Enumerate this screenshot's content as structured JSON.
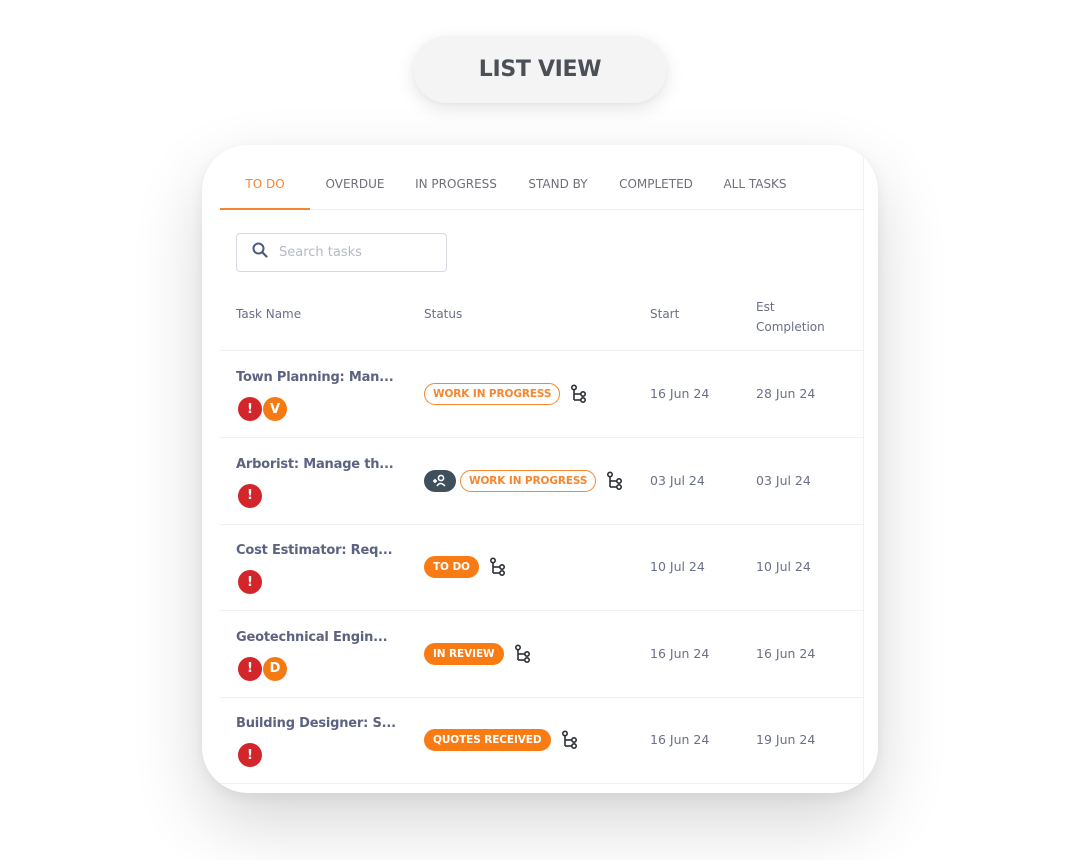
{
  "header": {
    "title": "LIST VIEW"
  },
  "tabs": [
    {
      "label": "TO DO",
      "active": true
    },
    {
      "label": "OVERDUE",
      "active": false
    },
    {
      "label": "IN PROGRESS",
      "active": false
    },
    {
      "label": "STAND BY",
      "active": false
    },
    {
      "label": "COMPLETED",
      "active": false
    },
    {
      "label": "ALL TASKS",
      "active": false
    }
  ],
  "search": {
    "placeholder": "Search tasks",
    "value": "",
    "icon": "search-icon"
  },
  "table": {
    "columns": {
      "name": "Task Name",
      "status": "Status",
      "start": "Start",
      "est_line1": "Est",
      "est_line2": "Completion"
    },
    "rows": [
      {
        "name": "Town Planning: Man...",
        "alert": "!",
        "avatar": "V",
        "assigned_icon": false,
        "status": "WORK IN PROGRESS",
        "status_style": "outline",
        "start": "16 Jun 24",
        "est": "28 Jun 24"
      },
      {
        "name": "Arborist: Manage th...",
        "alert": "!",
        "avatar": null,
        "assigned_icon": true,
        "status": "WORK IN PROGRESS",
        "status_style": "outline",
        "start": "03 Jul 24",
        "est": "03 Jul 24"
      },
      {
        "name": "Cost Estimator: Req...",
        "alert": "!",
        "avatar": null,
        "assigned_icon": false,
        "status": "TO DO",
        "status_style": "solid",
        "start": "10 Jul 24",
        "est": "10 Jul 24"
      },
      {
        "name": "Geotechnical Engin...",
        "alert": "!",
        "avatar": "D",
        "assigned_icon": false,
        "status": "IN REVIEW",
        "status_style": "solid",
        "start": "16 Jun 24",
        "est": "16 Jun 24"
      },
      {
        "name": "Building Designer: S...",
        "alert": "!",
        "avatar": null,
        "assigned_icon": false,
        "status": "QUOTES RECEIVED",
        "status_style": "solid",
        "start": "16 Jun 24",
        "est": "19 Jun 24"
      }
    ]
  },
  "colors": {
    "accent": "#f7862f",
    "alert": "#d3262b",
    "avatar": "#f47b14",
    "text": "#5b6381"
  }
}
